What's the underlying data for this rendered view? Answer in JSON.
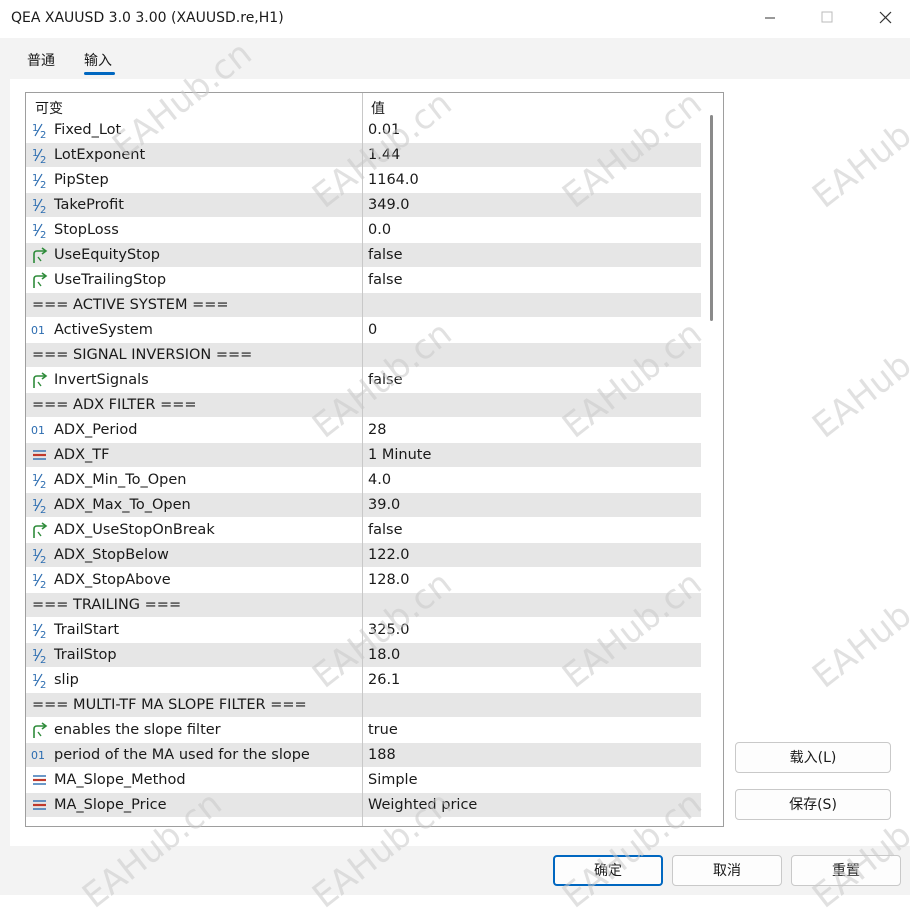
{
  "window": {
    "title": "QEA XAUUSD 3.0 3.00 (XAUUSD.re,H1)"
  },
  "tabs": [
    {
      "label": "普通"
    },
    {
      "label": "输入"
    }
  ],
  "grid": {
    "headers": {
      "variable": "可变",
      "value": "值"
    },
    "rows": [
      {
        "icon": "fraction-icon",
        "name": "Fixed_Lot",
        "value": "0.01"
      },
      {
        "icon": "fraction-icon",
        "name": "LotExponent",
        "value": "1.44"
      },
      {
        "icon": "fraction-icon",
        "name": "PipStep",
        "value": "1164.0"
      },
      {
        "icon": "fraction-icon",
        "name": "TakeProfit",
        "value": "349.0"
      },
      {
        "icon": "fraction-icon",
        "name": "StopLoss",
        "value": "0.0"
      },
      {
        "icon": "bool-arrow-icon",
        "name": "UseEquityStop",
        "value": "false"
      },
      {
        "icon": "bool-arrow-icon",
        "name": "UseTrailingStop",
        "value": "false"
      },
      {
        "icon": "",
        "name": "=== ACTIVE SYSTEM ===",
        "value": ""
      },
      {
        "icon": "int-icon",
        "name": "ActiveSystem",
        "value": "0"
      },
      {
        "icon": "",
        "name": "=== SIGNAL INVERSION ===",
        "value": ""
      },
      {
        "icon": "bool-arrow-icon",
        "name": "InvertSignals",
        "value": "false"
      },
      {
        "icon": "",
        "name": "=== ADX FILTER ===",
        "value": ""
      },
      {
        "icon": "int-icon",
        "name": "ADX_Period",
        "value": "28"
      },
      {
        "icon": "enum-icon",
        "name": "ADX_TF",
        "value": "1 Minute"
      },
      {
        "icon": "fraction-icon",
        "name": "ADX_Min_To_Open",
        "value": "4.0"
      },
      {
        "icon": "fraction-icon",
        "name": "ADX_Max_To_Open",
        "value": "39.0"
      },
      {
        "icon": "bool-arrow-icon",
        "name": "ADX_UseStopOnBreak",
        "value": "false"
      },
      {
        "icon": "fraction-icon",
        "name": "ADX_StopBelow",
        "value": "122.0"
      },
      {
        "icon": "fraction-icon",
        "name": "ADX_StopAbove",
        "value": "128.0"
      },
      {
        "icon": "",
        "name": "=== TRAILING ===",
        "value": ""
      },
      {
        "icon": "fraction-icon",
        "name": "TrailStart",
        "value": "325.0"
      },
      {
        "icon": "fraction-icon",
        "name": "TrailStop",
        "value": "18.0"
      },
      {
        "icon": "fraction-icon",
        "name": "slip",
        "value": "26.1"
      },
      {
        "icon": "",
        "name": "=== MULTI-TF MA SLOPE FILTER ===",
        "value": ""
      },
      {
        "icon": "bool-arrow-icon",
        "name": "enables the slope filter",
        "value": "true"
      },
      {
        "icon": "int-icon",
        "name": "period of the MA used for the slope",
        "value": "188"
      },
      {
        "icon": "enum-icon",
        "name": "MA_Slope_Method",
        "value": "Simple"
      },
      {
        "icon": "enum-icon",
        "name": "MA_Slope_Price",
        "value": "Weighted price"
      }
    ]
  },
  "buttons": {
    "load": "载入(L)",
    "save": "保存(S)",
    "ok": "确定",
    "cancel": "取消",
    "reset": "重置"
  },
  "watermark": "EAHub.cn",
  "colors": {
    "accent": "#0067c0",
    "row_alt": "#e6e6e6",
    "icon_blue": "#2b6cb0",
    "icon_green": "#2e8b3a",
    "icon_red": "#c0392b"
  }
}
